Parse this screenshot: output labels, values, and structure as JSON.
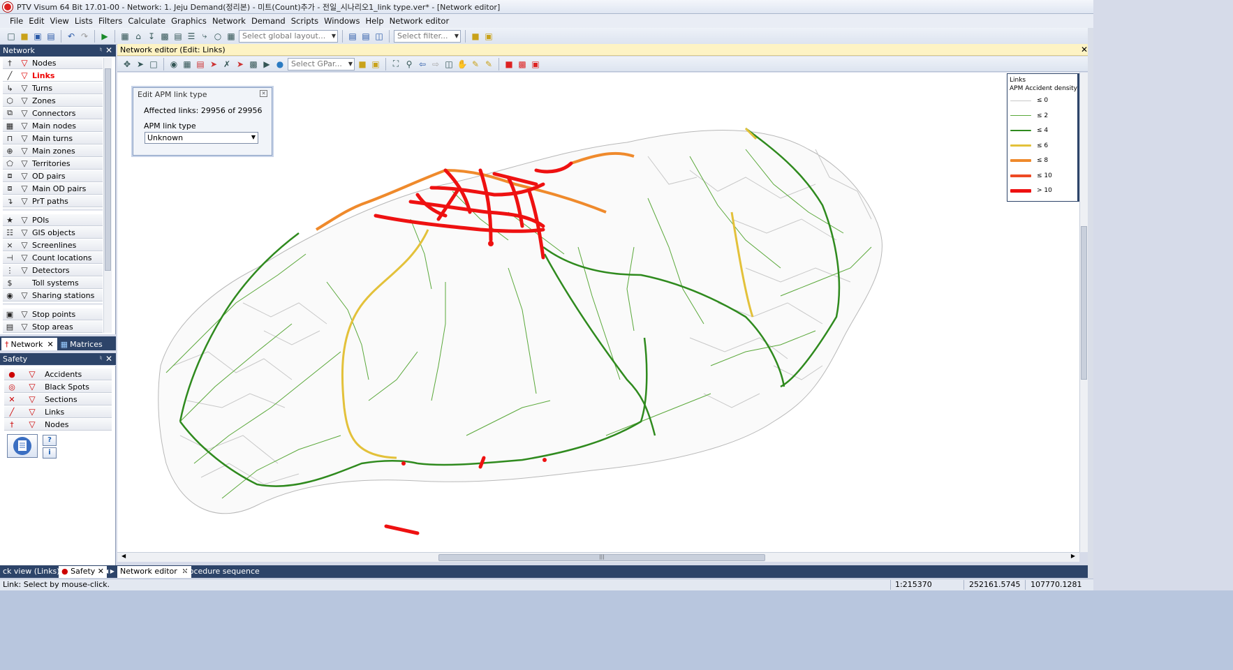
{
  "window": {
    "title": "PTV Visum 64 Bit 17.01-00 - Network: 1. Jeju Demand(정리본) - 미트(Count)추가 - 전일_시나리오1_link type.ver* - [Network editor]",
    "buttons": [
      "–",
      "❐",
      "✕"
    ]
  },
  "menu": [
    "File",
    "Edit",
    "View",
    "Lists",
    "Filters",
    "Calculate",
    "Graphics",
    "Network",
    "Demand",
    "Scripts",
    "Windows",
    "Help",
    "Network editor"
  ],
  "toolbar1": {
    "layout_placeholder": "Select global layout...",
    "filter_placeholder": "Select filter..."
  },
  "network_panel": {
    "title": "Network",
    "items": [
      {
        "icon": "node-icon",
        "glyph": "†",
        "label": "Nodes",
        "filter_red": true
      },
      {
        "icon": "link-icon",
        "glyph": "╱",
        "label": "Links",
        "filter_red": true,
        "selected": true
      },
      {
        "icon": "turn-icon",
        "glyph": "↳",
        "label": "Turns"
      },
      {
        "icon": "zone-icon",
        "glyph": "⬡",
        "label": "Zones"
      },
      {
        "icon": "connector-icon",
        "glyph": "⧉",
        "label": "Connectors"
      },
      {
        "icon": "main-node-icon",
        "glyph": "▦",
        "label": "Main nodes"
      },
      {
        "icon": "main-turn-icon",
        "glyph": "⊓",
        "label": "Main turns"
      },
      {
        "icon": "main-zone-icon",
        "glyph": "⊕",
        "label": "Main zones"
      },
      {
        "icon": "territory-icon",
        "glyph": "⬠",
        "label": "Territories"
      },
      {
        "icon": "od-pair-icon",
        "glyph": "⧈",
        "label": "OD pairs"
      },
      {
        "icon": "main-od-pair-icon",
        "glyph": "⧈",
        "label": "Main OD pairs"
      },
      {
        "icon": "prt-path-icon",
        "glyph": "↴",
        "label": "PrT paths"
      },
      {
        "icon": "poi-icon",
        "glyph": "★",
        "label": "POIs"
      },
      {
        "icon": "gis-object-icon",
        "glyph": "☷",
        "label": "GIS objects"
      },
      {
        "icon": "screenline-icon",
        "glyph": "⨯",
        "label": "Screenlines"
      },
      {
        "icon": "count-location-icon",
        "glyph": "⊣",
        "label": "Count locations"
      },
      {
        "icon": "detector-icon",
        "glyph": "⋮",
        "label": "Detectors"
      },
      {
        "icon": "toll-system-icon",
        "glyph": "$",
        "label": "Toll systems",
        "no_filter": true
      },
      {
        "icon": "sharing-station-icon",
        "glyph": "◉",
        "label": "Sharing stations"
      },
      {
        "icon": "stop-point-icon",
        "glyph": "▣",
        "label": "Stop points"
      },
      {
        "icon": "stop-area-icon",
        "glyph": "▤",
        "label": "Stop areas"
      }
    ],
    "tabs": [
      "Network",
      "Matrices"
    ]
  },
  "safety_panel": {
    "title": "Safety",
    "items": [
      {
        "icon": "accident-icon",
        "glyph": "●",
        "label": "Accidents"
      },
      {
        "icon": "black-spot-icon",
        "glyph": "◎",
        "label": "Black Spots"
      },
      {
        "icon": "section-icon",
        "glyph": "✕",
        "label": "Sections"
      },
      {
        "icon": "link-icon",
        "glyph": "╱",
        "label": "Links"
      },
      {
        "icon": "node-icon",
        "glyph": "†",
        "label": "Nodes"
      }
    ]
  },
  "editor": {
    "header": "Network editor (Edit: Links)",
    "gpar_placeholder": "Select GPar..."
  },
  "apm_dialog": {
    "title": "Edit APM link type",
    "affected": "Affected links: 29956 of 29956",
    "field_label": "APM link type",
    "field_value": "Unknown"
  },
  "legend": {
    "title": "Links",
    "subtitle": "APM Accident density",
    "entries": [
      {
        "label": "≤ 0",
        "color": "#c8c8c8",
        "width": 1
      },
      {
        "label": "≤ 2",
        "color": "#5aa83a",
        "width": 1
      },
      {
        "label": "≤ 4",
        "color": "#2f8a1e",
        "width": 2
      },
      {
        "label": "≤ 6",
        "color": "#e3c13a",
        "width": 3
      },
      {
        "label": "≤ 8",
        "color": "#ef8a2c",
        "width": 4
      },
      {
        "label": "≤ 10",
        "color": "#ee4a24",
        "width": 4
      },
      {
        "label": "> 10",
        "color": "#ee1111",
        "width": 5
      }
    ]
  },
  "bottom_tabs": {
    "left": [
      "ck view (Links)",
      "Safety"
    ],
    "right": [
      "Network editor",
      "Procedure sequence"
    ]
  },
  "status": {
    "message": "Link: Select by mouse-click.",
    "scale": "1:215370",
    "x": "252161.5745",
    "y": "107770.1281"
  }
}
